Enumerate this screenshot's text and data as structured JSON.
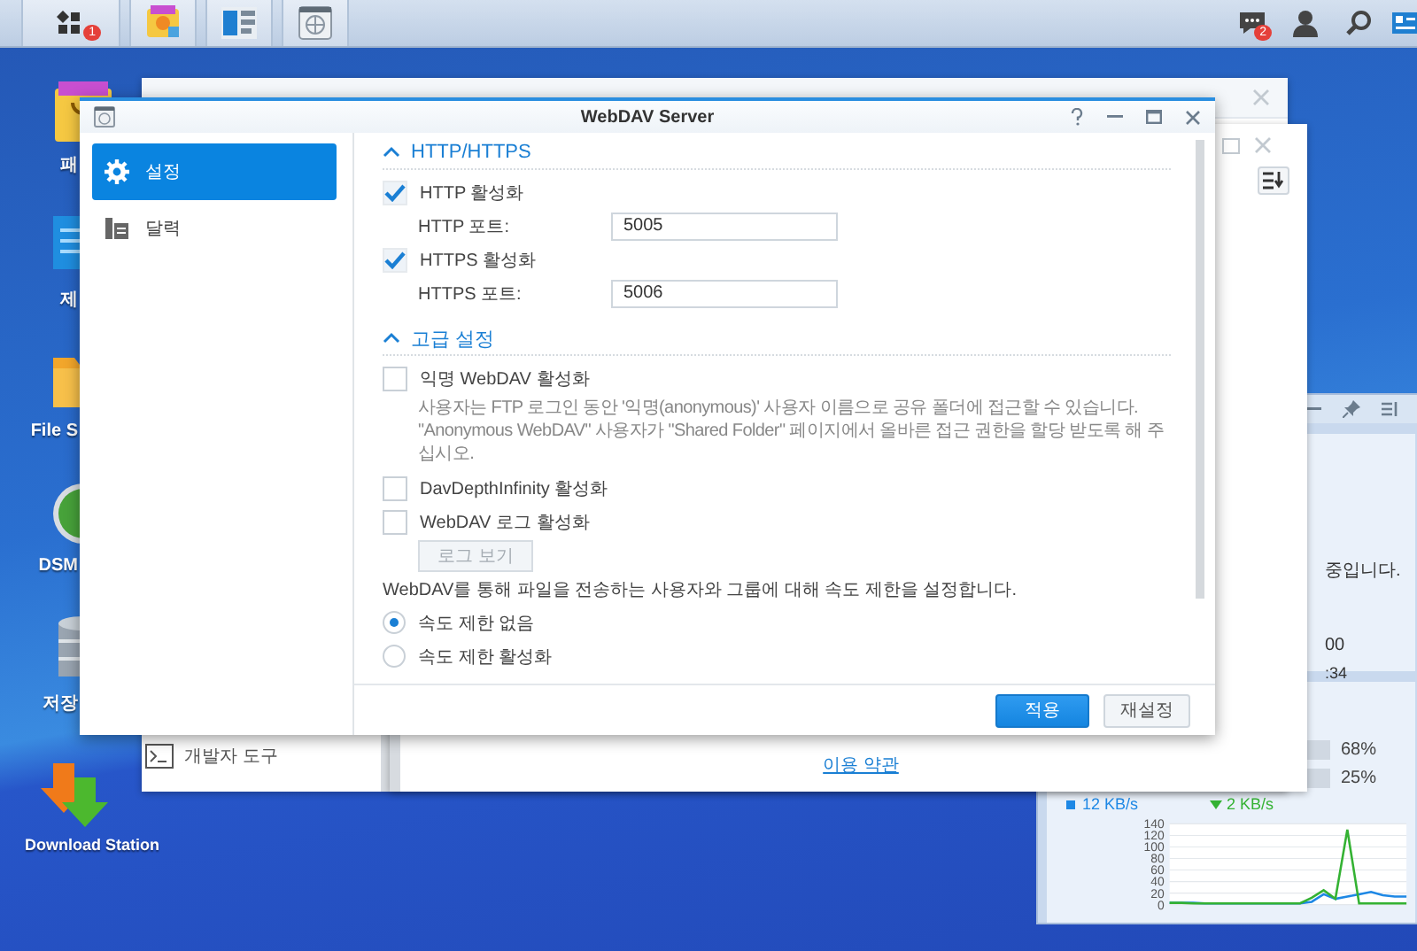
{
  "taskbar": {
    "main_menu_badge": "1",
    "notification_badge": "2"
  },
  "desktop_icons": [
    {
      "kind": "bag",
      "label": "패"
    },
    {
      "kind": "screen",
      "label": "제"
    },
    {
      "kind": "folder",
      "label": "File S"
    },
    {
      "kind": "globe",
      "label": "DSM"
    },
    {
      "kind": "database",
      "label": "저장"
    },
    {
      "kind": "arrows",
      "label": "Download Station"
    }
  ],
  "back_window": {
    "sidebar_item": "개발자 도구"
  },
  "middle_window": {
    "link": "이용 약관"
  },
  "widget": {
    "texts": [
      "중입니다.",
      "00",
      ":34"
    ],
    "meters": [
      {
        "reading": "68%"
      },
      {
        "reading": "25%"
      }
    ],
    "chart_data": {
      "type": "line",
      "grid": true,
      "ylim": [
        0,
        140
      ],
      "yticks": [
        0,
        20,
        40,
        60,
        80,
        100,
        120,
        140
      ],
      "series": [
        {
          "name": "12 KB/s",
          "color": "#1e88e5",
          "values": [
            3,
            3,
            3,
            2,
            2,
            2,
            2,
            2,
            2,
            2,
            2,
            2,
            5,
            18,
            10,
            14,
            18,
            22,
            16,
            14,
            14
          ]
        },
        {
          "name": "2 KB/s",
          "color": "#34b233",
          "values": [
            3,
            3,
            2,
            2,
            2,
            2,
            2,
            2,
            2,
            2,
            2,
            2,
            12,
            25,
            10,
            130,
            2,
            2,
            2,
            2,
            2
          ]
        }
      ]
    }
  },
  "window": {
    "title": "WebDAV Server",
    "sidebar": [
      {
        "label": "설정",
        "selected": true,
        "kind": "gear"
      },
      {
        "label": "달력",
        "selected": false,
        "kind": "log"
      }
    ],
    "sections": [
      {
        "title": "HTTP/HTTPS",
        "expanded": true,
        "rows": [
          {
            "kind": "checkbox",
            "label": "HTTP 활성화",
            "checked": true
          },
          {
            "kind": "field",
            "label": "HTTP 포트:",
            "value": "5005"
          },
          {
            "kind": "checkbox",
            "label": "HTTPS 활성화",
            "checked": true
          },
          {
            "kind": "field",
            "label": "HTTPS 포트:",
            "value": "5006"
          }
        ]
      },
      {
        "title": "고급 설정",
        "expanded": true,
        "rows": [
          {
            "kind": "checkbox",
            "label": "익명 WebDAV 활성화",
            "checked": false
          },
          {
            "kind": "note",
            "text": "사용자는 FTP 로그인 동안 '익명(anonymous)' 사용자 이름으로 공유 폴더에 접근할 수 있습니다. \"Anonymous WebDAV\" 사용자가 \"Shared Folder\" 페이지에서 올바른 접근 권한을 할당 받도록 해 주십시오."
          },
          {
            "kind": "checkbox",
            "label": "DavDepthInfinity 활성화",
            "checked": false
          },
          {
            "kind": "checkbox",
            "label": "WebDAV 로그 활성화",
            "checked": false
          },
          {
            "kind": "button",
            "label": "로그 보기",
            "disabled": true
          },
          {
            "kind": "text",
            "text": "WebDAV를 통해 파일을 전송하는 사용자와 그룹에 대해 속도 제한을 설정합니다."
          },
          {
            "kind": "radio",
            "label": "속도 제한 없음",
            "selected": true
          },
          {
            "kind": "radio",
            "label": "속도 제한 활성화",
            "selected": false
          }
        ]
      }
    ],
    "buttons": [
      {
        "label": "적용",
        "kind": "primary"
      },
      {
        "label": "재설정",
        "kind": "default"
      }
    ]
  }
}
